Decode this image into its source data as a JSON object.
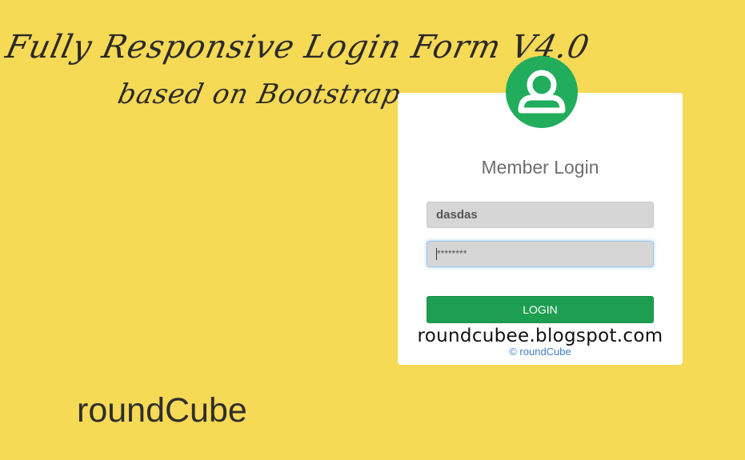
{
  "header": {
    "title_line_1": "Fully Responsive Login Form V4.0",
    "title_line_2": "based on Bootstrap"
  },
  "login": {
    "title": "Member Login",
    "username_value": "dasdas",
    "password_masked": "********",
    "button_label": "LOGIN",
    "avatar_icon": "user-icon",
    "copyright": "© roundCube"
  },
  "blog_url": "roundcubee.blogspot.com",
  "brand": "roundCube",
  "colors": {
    "background": "#f6d955",
    "accent_green": "#21ad5c",
    "button_green": "#1e9e50",
    "link_blue": "#3d7fc4"
  }
}
